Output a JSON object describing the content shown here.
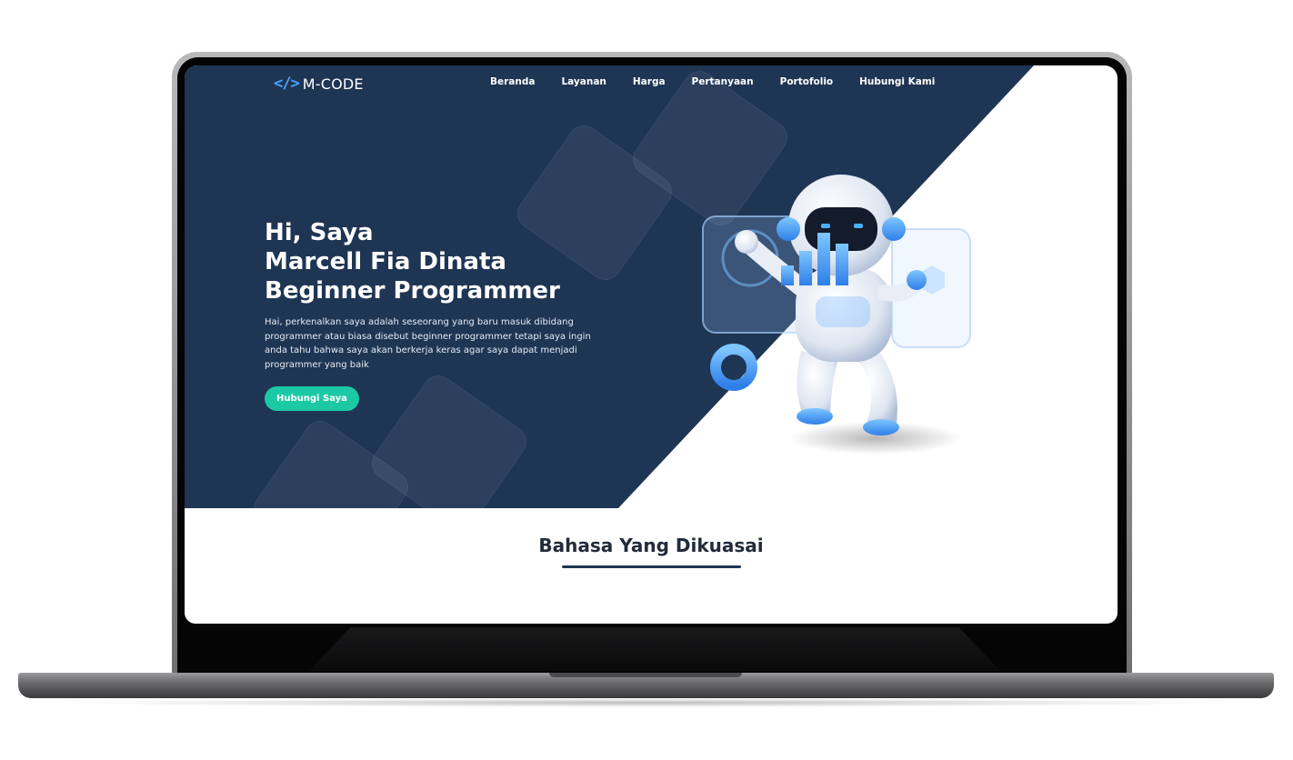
{
  "navbar": {
    "logo_icon": "</>",
    "logo_text": "M-CODE",
    "links": [
      "Beranda",
      "Layanan",
      "Harga",
      "Pertanyaan",
      "Portofolio",
      "Hubungi Kami"
    ]
  },
  "hero": {
    "title_line1": "Hi, Saya",
    "title_line2": "Marcell Fia Dinata",
    "title_line3": "Beginner Programmer",
    "description": "Hai, perkenalkan saya adalah seseorang yang baru masuk dibidang programmer atau biasa disebut beginner programmer tetapi saya ingin anda tahu bahwa saya akan berkerja keras agar saya dapat menjadi programmer yang baik",
    "cta_label": "Hubungi Saya",
    "illustration": "robot-illustration"
  },
  "section": {
    "title": "Bahasa Yang Dikuasai"
  },
  "colors": {
    "hero_bg": "#1f3554",
    "accent": "#1cc9a5",
    "logo_accent": "#4aa3ff",
    "section_title": "#222b3a"
  }
}
